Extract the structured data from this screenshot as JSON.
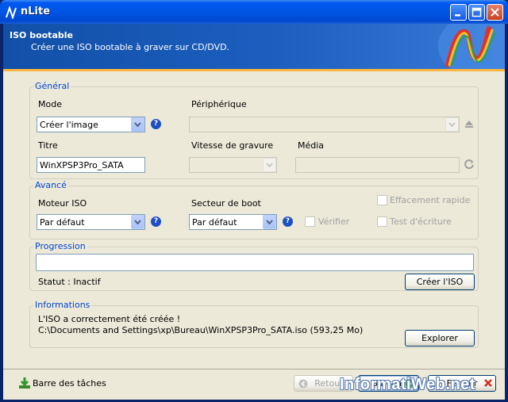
{
  "window": {
    "title": "nLite"
  },
  "header": {
    "title": "ISO bootable",
    "subtitle": "Créer une ISO bootable à graver sur CD/DVD."
  },
  "general": {
    "legend": "Général",
    "mode_label": "Mode",
    "mode_value": "Créer l'image",
    "device_label": "Périphérique",
    "title_label": "Titre",
    "title_value": "WinXPSP3Pro_SATA",
    "speed_label": "Vitesse de gravure",
    "media_label": "Média"
  },
  "advanced": {
    "legend": "Avancé",
    "engine_label": "Moteur ISO",
    "engine_value": "Par défaut",
    "boot_label": "Secteur de boot",
    "boot_value": "Par défaut",
    "verify_label": "Vérifier",
    "quick_erase_label": "Effacement rapide",
    "write_test_label": "Test d'écriture"
  },
  "progress": {
    "legend": "Progression",
    "status": "Statut : Inactif",
    "create_button": "Créer l'ISO"
  },
  "info": {
    "legend": "Informations",
    "line1": "L'ISO a correctement été créée !",
    "line2": "C:\\Documents and Settings\\xp\\Bureau\\WinXPSP3Pro_SATA.iso (593,25 Mo)",
    "explore_button": "Explorer"
  },
  "footer": {
    "taskbar_label": "Barre des tâches",
    "back_button": "Retour",
    "next_button": "Suivant",
    "close_button": "Fermer"
  },
  "watermark": "InformatiWeb.net"
}
